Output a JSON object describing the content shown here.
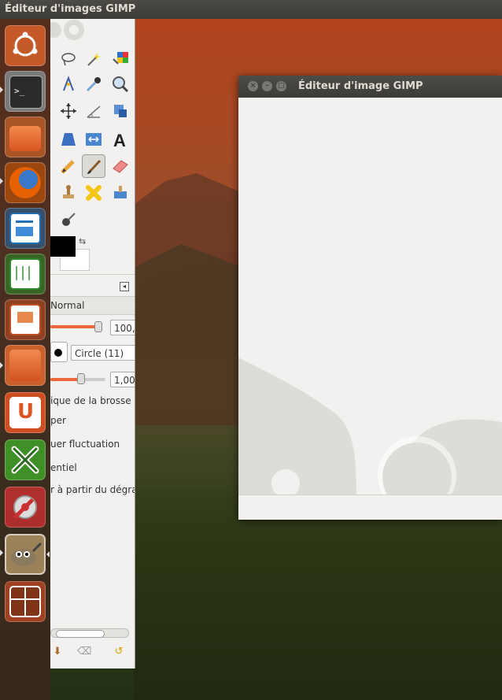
{
  "top_panel": {
    "title": "Éditeur d'images GIMP"
  },
  "launcher": {
    "items": [
      {
        "name": "ubuntu-dash-icon",
        "color": "#d8602b"
      },
      {
        "name": "terminal-icon",
        "color": "#2c2c2c"
      },
      {
        "name": "files-icon",
        "color": "#e46f2b"
      },
      {
        "name": "firefox-icon",
        "color": "#e66000"
      },
      {
        "name": "libreoffice-writer-icon",
        "color": "#1e6fb5"
      },
      {
        "name": "libreoffice-calc-icon",
        "color": "#2f8a2c"
      },
      {
        "name": "libreoffice-impress-icon",
        "color": "#c04f22"
      },
      {
        "name": "software-center-icon",
        "color": "#e0672b"
      },
      {
        "name": "ubuntu-one-icon",
        "color": "#df5221"
      },
      {
        "name": "xsane-icon",
        "color": "#3e9b28"
      },
      {
        "name": "system-settings-icon",
        "color": "#cc2f2f"
      },
      {
        "name": "gimp-icon",
        "color": "#8a7a5e"
      },
      {
        "name": "workspace-switcher-icon",
        "color": "#b24722"
      }
    ]
  },
  "toolbox": {
    "paint_mode": "Normal",
    "opacity_value": "100,",
    "brush_name": "Circle (11)",
    "size_value": "1,00",
    "options": [
      "ique de la brosse",
      "per",
      "uer fluctuation",
      "entiel",
      "r à partir du dégrad"
    ]
  },
  "image_window": {
    "title": "Éditeur d'image GIMP"
  },
  "colors": {
    "panel": "#3c3b37",
    "toolbox_bg": "#f2f1ef",
    "accent": "#e9673b"
  }
}
